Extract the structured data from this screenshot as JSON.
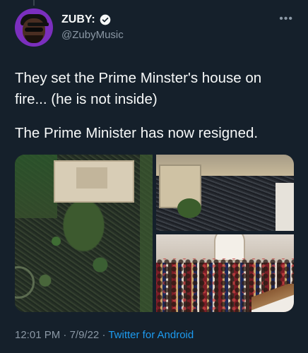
{
  "tweet": {
    "display_name": "ZUBY:",
    "handle": "@ZubyMusic",
    "more_icon": "ellipsis-icon",
    "verified_icon": "verified-badge-icon",
    "text_line1": "They set the Prime Minster's house on fire... (he is not inside)",
    "text_line2": "The Prime Minister has now resigned.",
    "time": "12:01 PM",
    "sep1": " · ",
    "date": "7/9/22",
    "sep2": " · ",
    "source": "Twitter for Android"
  },
  "colors": {
    "background": "#15202b",
    "text": "#f7f9f9",
    "muted": "#8b98a5",
    "link": "#1d9bf0"
  }
}
